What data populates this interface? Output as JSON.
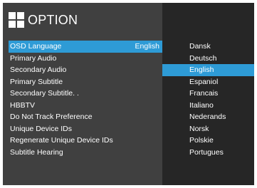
{
  "header": {
    "icon": "grid-icon",
    "title": "OPTION"
  },
  "menu": {
    "items": [
      {
        "label": "OSD Language",
        "value": "English"
      },
      {
        "label": "Primary Audio",
        "value": ""
      },
      {
        "label": "Secondary Audio",
        "value": ""
      },
      {
        "label": "Primary Subtitle",
        "value": ""
      },
      {
        "label": "Secondary Subtitle. .",
        "value": ""
      },
      {
        "label": "HBBTV",
        "value": ""
      },
      {
        "label": "Do Not Track Preference",
        "value": ""
      },
      {
        "label": "Unique Device IDs",
        "value": ""
      },
      {
        "label": "Regenerate Unique Device IDs",
        "value": ""
      },
      {
        "label": "Subtitle Hearing",
        "value": ""
      }
    ],
    "selected_index": 0
  },
  "languages": {
    "options": [
      "Dansk",
      "Deutsch",
      "English",
      "Espaniol",
      "Francais",
      "Italiano",
      "Nederands",
      "Norsk",
      "Polskie",
      "Portugues"
    ],
    "selected_index": 2
  },
  "colors": {
    "highlight": "#2e9bd6",
    "panel_left": "#404040",
    "panel_right": "#262626",
    "text": "#ffffff"
  }
}
